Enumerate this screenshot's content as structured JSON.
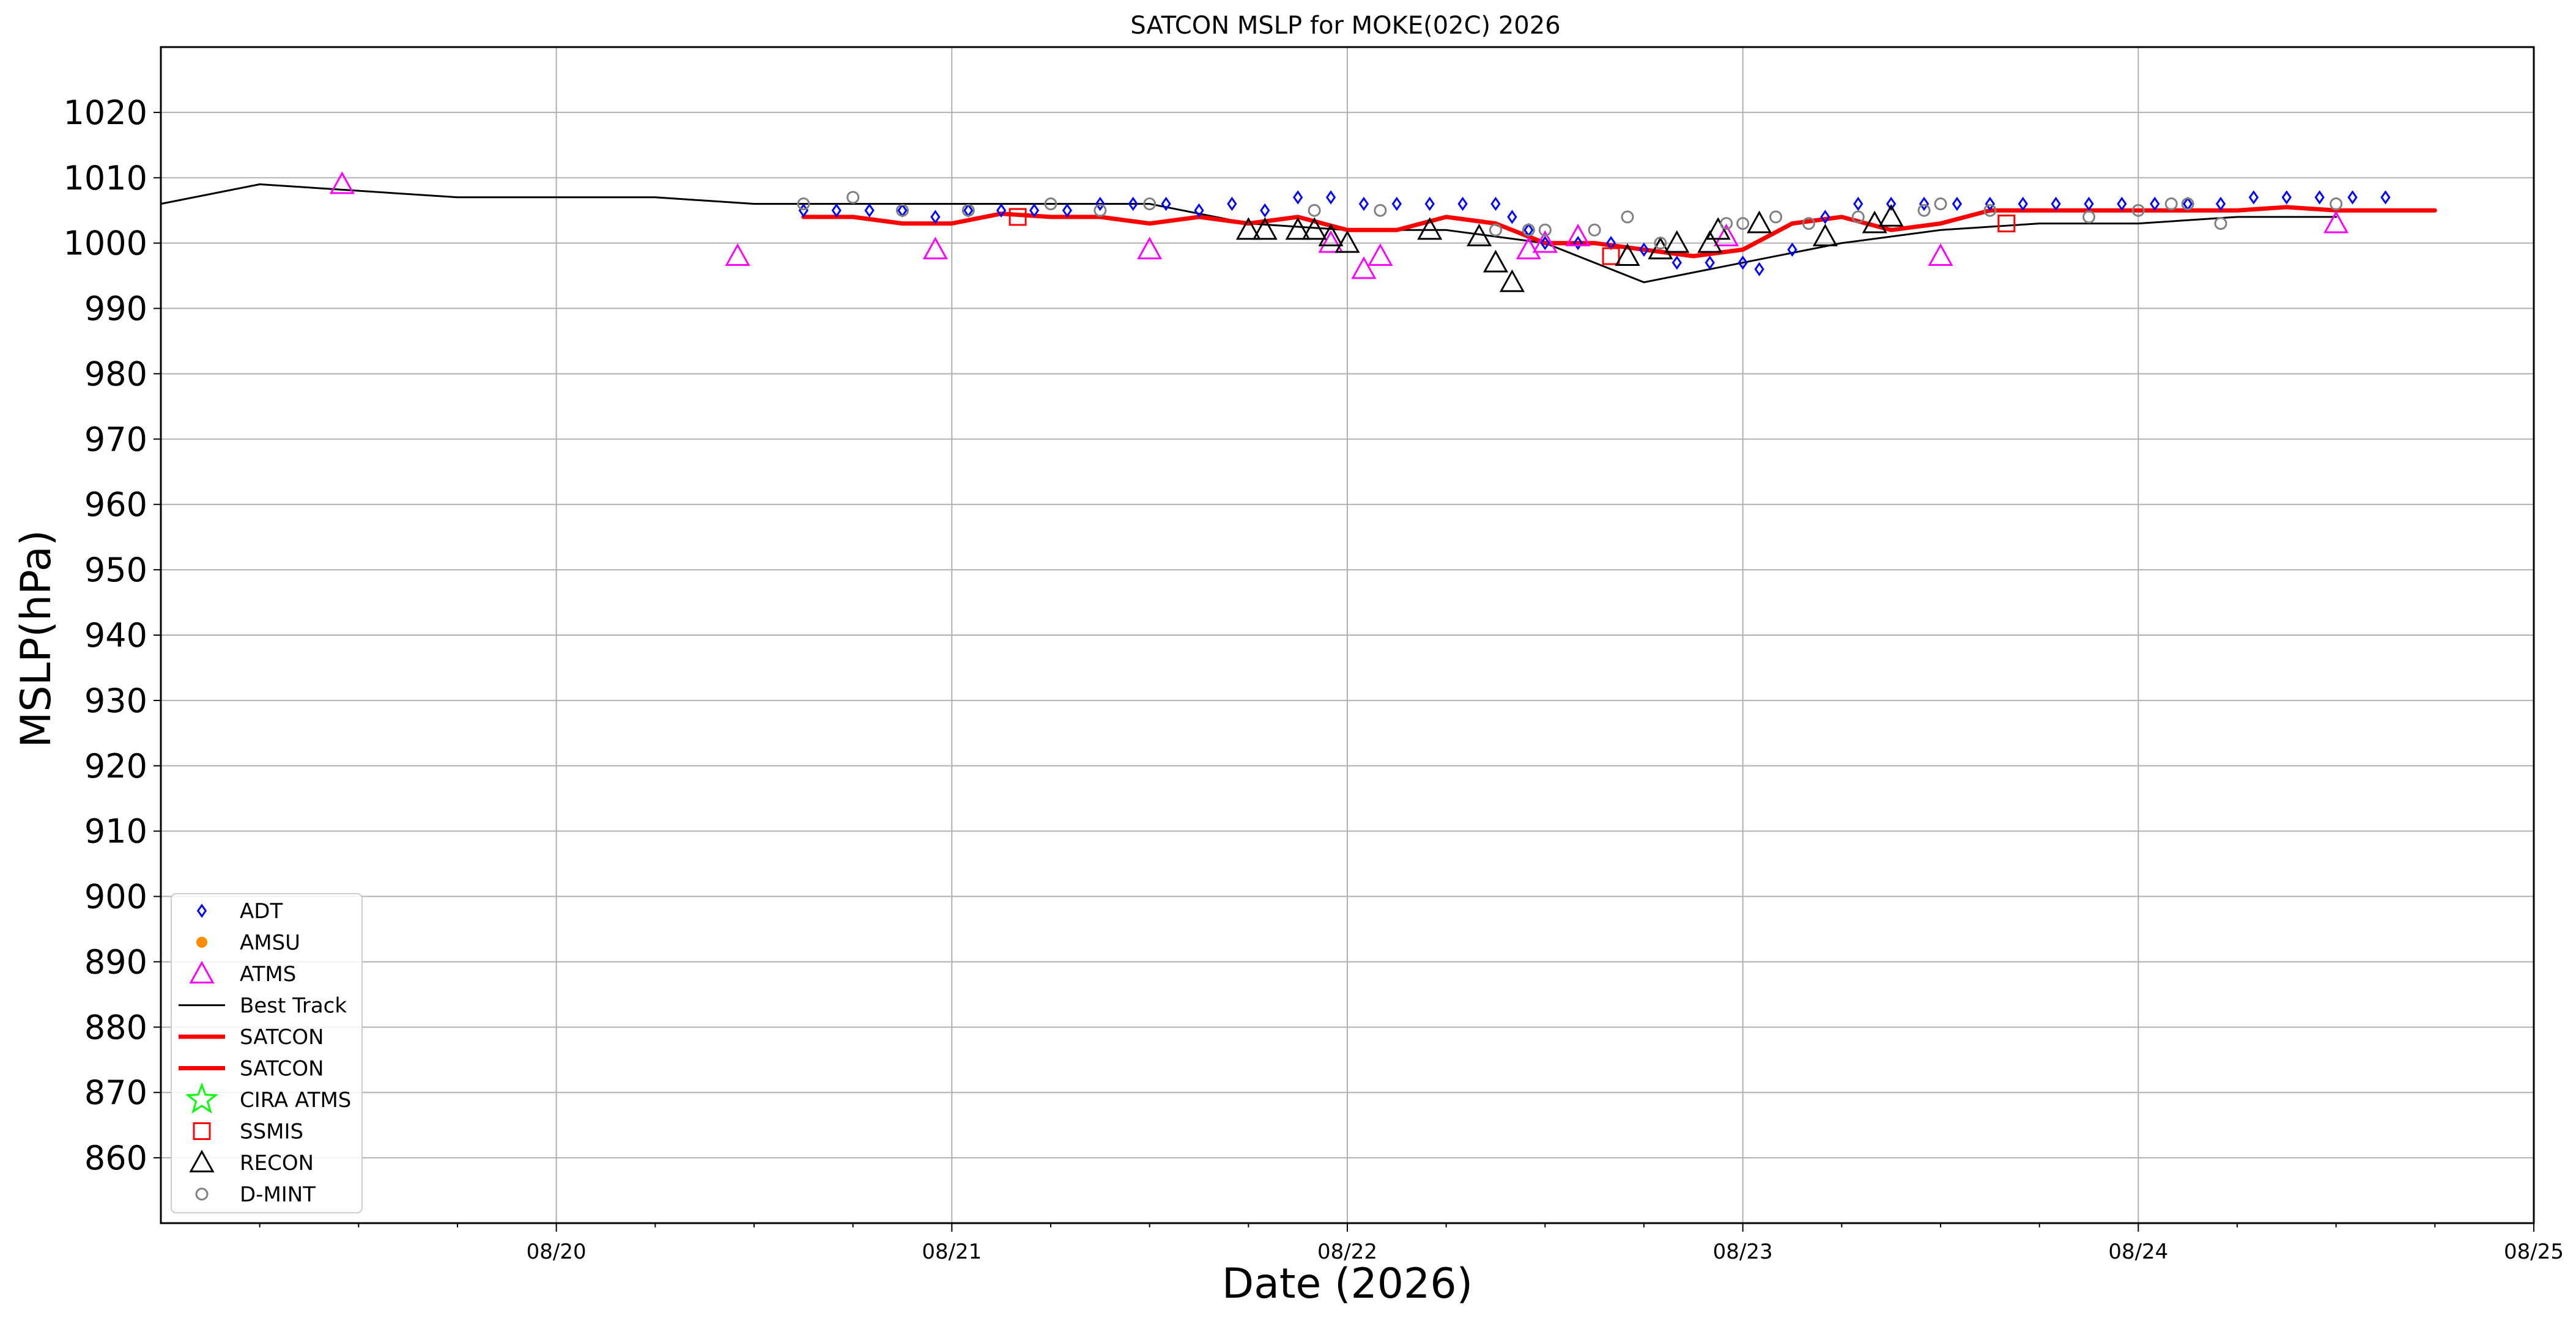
{
  "chart_data": {
    "type": "scatter",
    "title": "SATCON MSLP for MOKE(02C) 2026",
    "xlabel": "Date (2026)",
    "ylabel": "MSLP(hPa)",
    "xlim": [
      "2026-08-19 00:00",
      "2026-08-25 00:00"
    ],
    "ylim": [
      850,
      1030
    ],
    "yticks": [
      860,
      870,
      880,
      890,
      900,
      910,
      920,
      930,
      940,
      950,
      960,
      970,
      980,
      990,
      1000,
      1010,
      1020
    ],
    "xticks": [
      {
        "date": "2026-08-20 00:00",
        "label": "08/20"
      },
      {
        "date": "2026-08-21 00:00",
        "label": "08/21"
      },
      {
        "date": "2026-08-22 00:00",
        "label": "08/22"
      },
      {
        "date": "2026-08-23 00:00",
        "label": "08/23"
      },
      {
        "date": "2026-08-24 00:00",
        "label": "08/24"
      },
      {
        "date": "2026-08-25 00:00",
        "label": "08/25"
      }
    ],
    "grid": true,
    "legend_position": "lower-left",
    "legend": [
      {
        "label": "ADT",
        "marker": "diamond",
        "color": "#0000ff"
      },
      {
        "label": "AMSU",
        "marker": "dot",
        "color": "#ff8c00"
      },
      {
        "label": "ATMS",
        "marker": "triangle",
        "color": "#ff00ff"
      },
      {
        "label": "Best Track",
        "marker": "line",
        "color": "#000000"
      },
      {
        "label": "SATCON",
        "marker": "thickline",
        "color": "#ff0000"
      },
      {
        "label": "SATCON",
        "marker": "thickline",
        "color": "#ff0000"
      },
      {
        "label": "CIRA ATMS",
        "marker": "star",
        "color": "#00ff00"
      },
      {
        "label": "SSMIS",
        "marker": "square",
        "color": "#ff0000"
      },
      {
        "label": "RECON",
        "marker": "triangle",
        "color": "#000000"
      },
      {
        "label": "D-MINT",
        "marker": "circle",
        "color": "#808080"
      }
    ],
    "series": [
      {
        "name": "Best Track",
        "kind": "line",
        "color": "#000000",
        "points": [
          [
            "2026-08-19 00:00",
            1006
          ],
          [
            "2026-08-19 06:00",
            1009
          ],
          [
            "2026-08-19 18:00",
            1007
          ],
          [
            "2026-08-20 06:00",
            1007
          ],
          [
            "2026-08-20 12:00",
            1006
          ],
          [
            "2026-08-21 00:00",
            1006
          ],
          [
            "2026-08-21 12:00",
            1006
          ],
          [
            "2026-08-21 18:00",
            1003
          ],
          [
            "2026-08-22 00:00",
            1002
          ],
          [
            "2026-08-22 06:00",
            1002
          ],
          [
            "2026-08-22 12:00",
            1000
          ],
          [
            "2026-08-22 18:00",
            994
          ],
          [
            "2026-08-23 00:00",
            997
          ],
          [
            "2026-08-23 06:00",
            1000
          ],
          [
            "2026-08-23 12:00",
            1002
          ],
          [
            "2026-08-23 18:00",
            1003
          ],
          [
            "2026-08-24 00:00",
            1003
          ],
          [
            "2026-08-24 06:00",
            1004
          ],
          [
            "2026-08-24 12:00",
            1004
          ]
        ]
      },
      {
        "name": "SATCON",
        "kind": "line",
        "color": "#ff0000",
        "points": [
          [
            "2026-08-20 15:00",
            1004
          ],
          [
            "2026-08-20 18:00",
            1004
          ],
          [
            "2026-08-20 21:00",
            1003
          ],
          [
            "2026-08-21 00:00",
            1003
          ],
          [
            "2026-08-21 03:00",
            1004.5
          ],
          [
            "2026-08-21 06:00",
            1004
          ],
          [
            "2026-08-21 09:00",
            1004
          ],
          [
            "2026-08-21 12:00",
            1003
          ],
          [
            "2026-08-21 15:00",
            1004
          ],
          [
            "2026-08-21 18:00",
            1003
          ],
          [
            "2026-08-21 21:00",
            1004
          ],
          [
            "2026-08-22 00:00",
            1002
          ],
          [
            "2026-08-22 03:00",
            1002
          ],
          [
            "2026-08-22 06:00",
            1004
          ],
          [
            "2026-08-22 09:00",
            1003
          ],
          [
            "2026-08-22 12:00",
            1000
          ],
          [
            "2026-08-22 15:00",
            1000
          ],
          [
            "2026-08-22 18:00",
            999
          ],
          [
            "2026-08-22 21:00",
            998
          ],
          [
            "2026-08-23 00:00",
            999
          ],
          [
            "2026-08-23 03:00",
            1003
          ],
          [
            "2026-08-23 06:00",
            1004
          ],
          [
            "2026-08-23 09:00",
            1002
          ],
          [
            "2026-08-23 12:00",
            1003
          ],
          [
            "2026-08-23 15:00",
            1005
          ],
          [
            "2026-08-23 18:00",
            1005
          ],
          [
            "2026-08-23 21:00",
            1005
          ],
          [
            "2026-08-24 00:00",
            1005
          ],
          [
            "2026-08-24 06:00",
            1005
          ],
          [
            "2026-08-24 09:00",
            1005.5
          ],
          [
            "2026-08-24 12:00",
            1005
          ],
          [
            "2026-08-24 15:00",
            1005
          ],
          [
            "2026-08-24 18:00",
            1005
          ]
        ]
      },
      {
        "name": "ADT",
        "kind": "diamond",
        "color": "#0000ff",
        "points": [
          [
            "2026-08-20 15:00",
            1005
          ],
          [
            "2026-08-20 17:00",
            1005
          ],
          [
            "2026-08-20 19:00",
            1005
          ],
          [
            "2026-08-20 21:00",
            1005
          ],
          [
            "2026-08-20 23:00",
            1004
          ],
          [
            "2026-08-21 01:00",
            1005
          ],
          [
            "2026-08-21 03:00",
            1005
          ],
          [
            "2026-08-21 05:00",
            1005
          ],
          [
            "2026-08-21 07:00",
            1005
          ],
          [
            "2026-08-21 09:00",
            1006
          ],
          [
            "2026-08-21 11:00",
            1006
          ],
          [
            "2026-08-21 13:00",
            1006
          ],
          [
            "2026-08-21 15:00",
            1005
          ],
          [
            "2026-08-21 17:00",
            1006
          ],
          [
            "2026-08-21 19:00",
            1005
          ],
          [
            "2026-08-21 21:00",
            1007
          ],
          [
            "2026-08-21 23:00",
            1007
          ],
          [
            "2026-08-22 01:00",
            1006
          ],
          [
            "2026-08-22 03:00",
            1006
          ],
          [
            "2026-08-22 05:00",
            1006
          ],
          [
            "2026-08-22 07:00",
            1006
          ],
          [
            "2026-08-22 09:00",
            1006
          ],
          [
            "2026-08-22 10:00",
            1004
          ],
          [
            "2026-08-22 11:00",
            1002
          ],
          [
            "2026-08-22 12:00",
            1000
          ],
          [
            "2026-08-22 14:00",
            1000
          ],
          [
            "2026-08-22 16:00",
            1000
          ],
          [
            "2026-08-22 18:00",
            999
          ],
          [
            "2026-08-22 20:00",
            997
          ],
          [
            "2026-08-22 22:00",
            997
          ],
          [
            "2026-08-23 00:00",
            997
          ],
          [
            "2026-08-23 01:00",
            996
          ],
          [
            "2026-08-23 03:00",
            999
          ],
          [
            "2026-08-23 05:00",
            1004
          ],
          [
            "2026-08-23 07:00",
            1006
          ],
          [
            "2026-08-23 09:00",
            1006
          ],
          [
            "2026-08-23 11:00",
            1006
          ],
          [
            "2026-08-23 13:00",
            1006
          ],
          [
            "2026-08-23 15:00",
            1006
          ],
          [
            "2026-08-23 17:00",
            1006
          ],
          [
            "2026-08-23 19:00",
            1006
          ],
          [
            "2026-08-23 21:00",
            1006
          ],
          [
            "2026-08-23 23:00",
            1006
          ],
          [
            "2026-08-24 01:00",
            1006
          ],
          [
            "2026-08-24 03:00",
            1006
          ],
          [
            "2026-08-24 05:00",
            1006
          ],
          [
            "2026-08-24 07:00",
            1007
          ],
          [
            "2026-08-24 09:00",
            1007
          ],
          [
            "2026-08-24 11:00",
            1007
          ],
          [
            "2026-08-24 13:00",
            1007
          ],
          [
            "2026-08-24 15:00",
            1007
          ]
        ]
      },
      {
        "name": "ATMS",
        "kind": "triangle",
        "color": "#ff00ff",
        "points": [
          [
            "2026-08-19 11:00",
            1009
          ],
          [
            "2026-08-20 11:00",
            998
          ],
          [
            "2026-08-20 23:00",
            999
          ],
          [
            "2026-08-21 12:00",
            999
          ],
          [
            "2026-08-21 23:00",
            1000
          ],
          [
            "2026-08-22 01:00",
            996
          ],
          [
            "2026-08-22 02:00",
            998
          ],
          [
            "2026-08-22 11:00",
            999
          ],
          [
            "2026-08-22 12:00",
            1000
          ],
          [
            "2026-08-22 14:00",
            1001
          ],
          [
            "2026-08-22 23:00",
            1001
          ],
          [
            "2026-08-23 12:00",
            998
          ],
          [
            "2026-08-24 12:00",
            1003
          ]
        ]
      },
      {
        "name": "SSMIS",
        "kind": "square",
        "color": "#ff0000",
        "points": [
          [
            "2026-08-21 04:00",
            1004
          ],
          [
            "2026-08-22 16:00",
            998
          ],
          [
            "2026-08-23 16:00",
            1003
          ]
        ]
      },
      {
        "name": "RECON",
        "kind": "triangle",
        "color": "#000000",
        "points": [
          [
            "2026-08-21 18:00",
            1002
          ],
          [
            "2026-08-21 19:00",
            1002
          ],
          [
            "2026-08-21 21:00",
            1002
          ],
          [
            "2026-08-21 22:00",
            1002
          ],
          [
            "2026-08-21 23:00",
            1001
          ],
          [
            "2026-08-22 00:00",
            1000
          ],
          [
            "2026-08-22 05:00",
            1002
          ],
          [
            "2026-08-22 08:00",
            1001
          ],
          [
            "2026-08-22 09:00",
            997
          ],
          [
            "2026-08-22 10:00",
            994
          ],
          [
            "2026-08-22 17:00",
            998
          ],
          [
            "2026-08-22 19:00",
            999
          ],
          [
            "2026-08-22 20:00",
            1000
          ],
          [
            "2026-08-22 22:00",
            1000
          ],
          [
            "2026-08-22 22:30",
            1002
          ],
          [
            "2026-08-23 01:00",
            1003
          ],
          [
            "2026-08-23 05:00",
            1001
          ],
          [
            "2026-08-23 08:00",
            1003
          ],
          [
            "2026-08-23 09:00",
            1004
          ]
        ]
      },
      {
        "name": "D-MINT",
        "kind": "circle",
        "color": "#808080",
        "points": [
          [
            "2026-08-20 15:00",
            1006
          ],
          [
            "2026-08-20 18:00",
            1007
          ],
          [
            "2026-08-20 21:00",
            1005
          ],
          [
            "2026-08-21 01:00",
            1005
          ],
          [
            "2026-08-21 06:00",
            1006
          ],
          [
            "2026-08-21 09:00",
            1005
          ],
          [
            "2026-08-21 12:00",
            1006
          ],
          [
            "2026-08-21 22:00",
            1005
          ],
          [
            "2026-08-22 02:00",
            1005
          ],
          [
            "2026-08-22 09:00",
            1002
          ],
          [
            "2026-08-22 11:00",
            1002
          ],
          [
            "2026-08-22 12:00",
            1002
          ],
          [
            "2026-08-22 15:00",
            1002
          ],
          [
            "2026-08-22 17:00",
            1004
          ],
          [
            "2026-08-22 19:00",
            1000
          ],
          [
            "2026-08-22 23:00",
            1003
          ],
          [
            "2026-08-23 00:00",
            1003
          ],
          [
            "2026-08-23 02:00",
            1004
          ],
          [
            "2026-08-23 04:00",
            1003
          ],
          [
            "2026-08-23 07:00",
            1004
          ],
          [
            "2026-08-23 11:00",
            1005
          ],
          [
            "2026-08-23 12:00",
            1006
          ],
          [
            "2026-08-23 15:00",
            1005
          ],
          [
            "2026-08-23 21:00",
            1004
          ],
          [
            "2026-08-24 00:00",
            1005
          ],
          [
            "2026-08-24 02:00",
            1006
          ],
          [
            "2026-08-24 03:00",
            1006
          ],
          [
            "2026-08-24 05:00",
            1003
          ],
          [
            "2026-08-24 12:00",
            1006
          ]
        ]
      }
    ]
  }
}
